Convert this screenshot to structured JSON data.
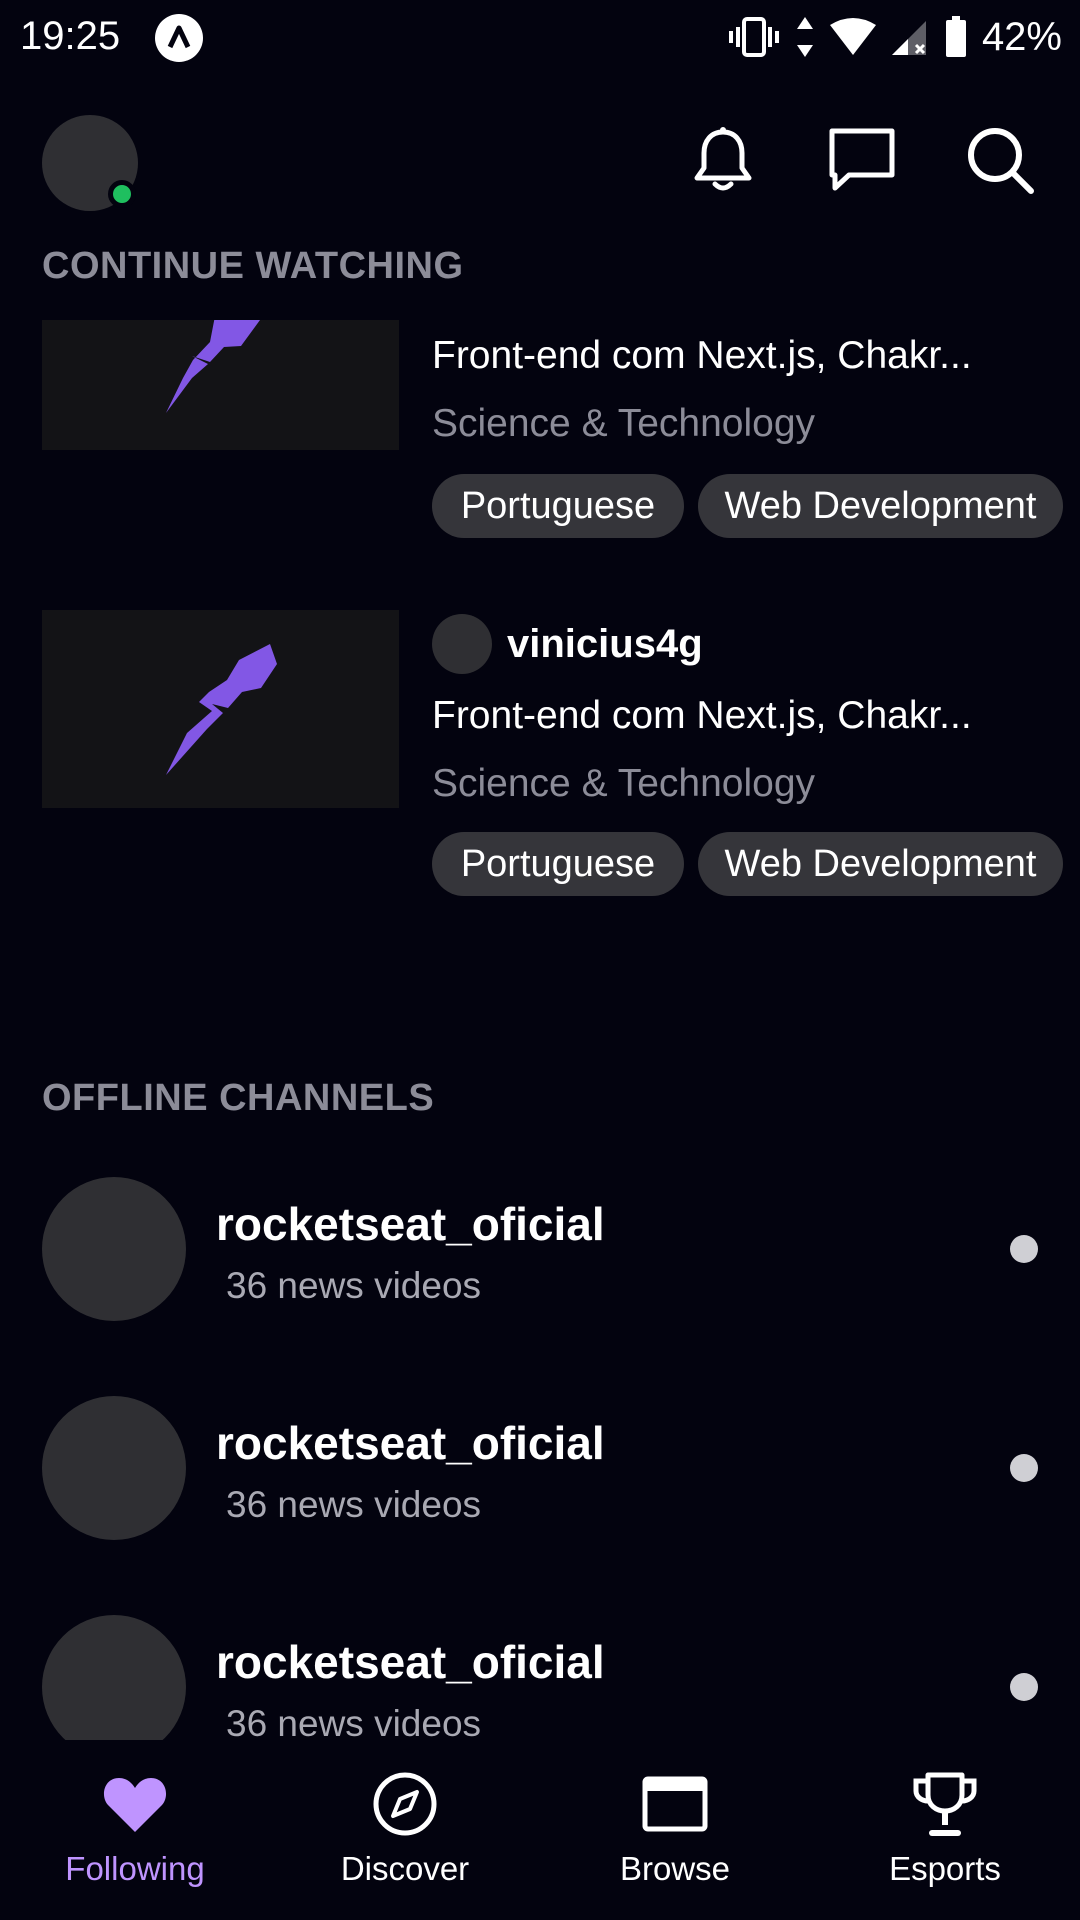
{
  "status_bar": {
    "time": "19:25",
    "battery": "42%",
    "icons": [
      "vibrate-icon",
      "data-arrows-icon",
      "wifi-icon",
      "signal-icon",
      "battery-icon"
    ]
  },
  "header": {
    "avatar_status": "online",
    "icons": [
      "bell-icon",
      "message-icon",
      "search-icon"
    ]
  },
  "sections": {
    "continue_watching": "CONTINUE WATCHING",
    "offline_channels": "OFFLINE CHANNELS"
  },
  "videos": [
    {
      "title": "Front-end com Next.js, Chakr...",
      "category": "Science & Technology",
      "tags": [
        "Portuguese",
        "Web Development"
      ]
    },
    {
      "streamer": "vinicius4g",
      "title": "Front-end com Next.js, Chakr...",
      "category": "Science & Technology",
      "tags": [
        "Portuguese",
        "Web Development"
      ]
    }
  ],
  "channels": [
    {
      "name": "rocketseat_oficial",
      "subtitle": "36 news videos"
    },
    {
      "name": "rocketseat_oficial",
      "subtitle": "36 news videos"
    },
    {
      "name": "rocketseat_oficial",
      "subtitle": "36 news videos"
    }
  ],
  "nav": {
    "items": [
      {
        "label": "Following",
        "icon": "heart-icon",
        "active": true
      },
      {
        "label": "Discover",
        "icon": "compass-icon",
        "active": false
      },
      {
        "label": "Browse",
        "icon": "browse-icon",
        "active": false
      },
      {
        "label": "Esports",
        "icon": "trophy-icon",
        "active": false
      }
    ]
  },
  "colors": {
    "background": "#03030f",
    "accent": "#bf94ff",
    "brand_purple": "#8257e5",
    "online": "#1fbf5f",
    "tag_bg": "#35353a",
    "muted_text": "#8c8c98"
  }
}
